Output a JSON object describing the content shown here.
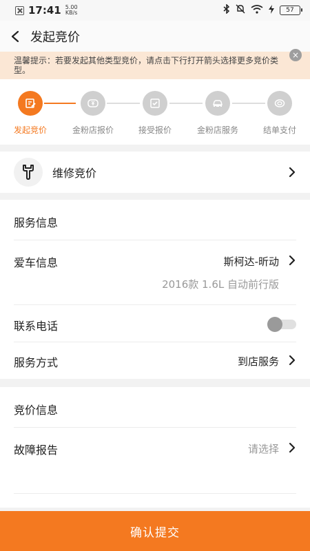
{
  "status_bar": {
    "time": "17:41",
    "net_speed_value": "5.00",
    "net_speed_unit": "KB/s",
    "battery": "57"
  },
  "nav": {
    "title": "发起竞价"
  },
  "tip": {
    "text": "温馨提示：若要发起其他类型竞价，请点击下行打开箭头选择更多竞价类型。",
    "close_glyph": "×"
  },
  "steps": [
    {
      "label": "发起竞价",
      "active": true
    },
    {
      "label": "金粉店报价",
      "active": false
    },
    {
      "label": "接受报价",
      "active": false
    },
    {
      "label": "金粉店服务",
      "active": false
    },
    {
      "label": "结单支付",
      "active": false
    }
  ],
  "bid_type": {
    "label": "维修竞价",
    "icon": "wrench-icon"
  },
  "service_info": {
    "title": "服务信息",
    "car_label": "爱车信息",
    "car_value": "斯柯达-昕动",
    "car_sub": "2016款 1.6L 自动前行版",
    "phone_label": "联系电话",
    "phone_toggle_on": false,
    "method_label": "服务方式",
    "method_value": "到店服务"
  },
  "bid_info": {
    "title": "竞价信息",
    "fault_label": "故障报告",
    "fault_placeholder": "请选择"
  },
  "submit": {
    "label": "确认提交"
  },
  "colors": {
    "accent": "#f47920",
    "tip_bg": "#fbe7d5",
    "inactive": "#cfcfcf"
  }
}
